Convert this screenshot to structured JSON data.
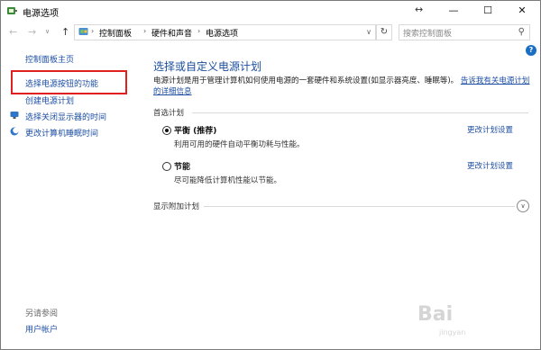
{
  "window": {
    "title": "电源选项",
    "resize_glyph": "↔",
    "controls": {
      "minimize": "—",
      "maximize": "☐",
      "close": "✕"
    }
  },
  "nav": {
    "back": "←",
    "forward": "→",
    "up": "↑",
    "recent": "∨",
    "crumbs": [
      "控制面板",
      "硬件和声音",
      "电源选项"
    ],
    "crumb_sep": "›",
    "dropdown": "∨",
    "refresh": "↻",
    "search_placeholder": "搜索控制面板",
    "search_glyph": "⚲"
  },
  "help_glyph": "?",
  "left": {
    "home": "控制面板主页",
    "items": [
      {
        "label": "选择电源按钮的功能",
        "icon": ""
      },
      {
        "label": "创建电源计划",
        "icon": ""
      },
      {
        "label": "选择关闭显示器的时间",
        "icon": "monitor-icon"
      },
      {
        "label": "更改计算机睡眠时间",
        "icon": "moon-icon"
      }
    ],
    "see_also": "另请参阅",
    "user_accounts": "用户帐户"
  },
  "main": {
    "title": "选择或自定义电源计划",
    "description": "电源计划是用于管理计算机如何使用电源的一套硬件和系统设置(如显示器亮度、睡眠等)。",
    "description_link": "告诉我有关电源计划的详细信息",
    "preferred_label": "首选计划",
    "plans": [
      {
        "name": "平衡 (推荐)",
        "desc": "利用可用的硬件自动平衡功耗与性能。",
        "change": "更改计划设置",
        "selected": true
      },
      {
        "name": "节能",
        "desc": "尽可能降低计算机性能以节能。",
        "change": "更改计划设置",
        "selected": false
      }
    ],
    "additional_label": "显示附加计划",
    "expand_glyph": "∨"
  },
  "colors": {
    "link": "#1c4ea3",
    "title": "#1b4fa0",
    "highlight": "#e01f1f"
  },
  "watermark": {
    "text": "Bai",
    "sub": "jingyan"
  }
}
